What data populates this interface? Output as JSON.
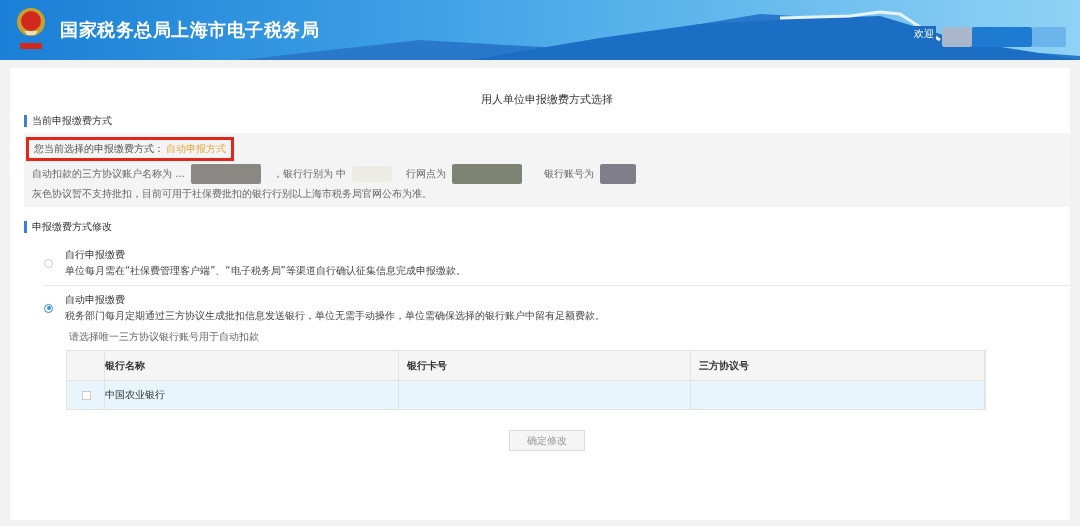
{
  "header": {
    "title": "国家税务总局上海市电子税务局",
    "welcome": "欢迎"
  },
  "page_title": "用人单位申报缴费方式选择",
  "current": {
    "heading": "当前申报缴费方式",
    "label": "您当前选择的申报缴费方式：",
    "value": "自动申报方式",
    "details": [
      "自动扣款的三方协议账户名称为 ...",
      "，银行行别为 中",
      "行网点为",
      "银行账号为"
    ],
    "note": "灰色协议暂不支持批扣，目前可用于社保费批扣的银行行别以上海市税务局官网公布为准。"
  },
  "change": {
    "heading": "申报缴费方式修改",
    "options": [
      {
        "title": "自行申报缴费",
        "description": "单位每月需在“社保费管理客户端”、“电子税务局”等渠道自行确认征集信息完成申报缴款。",
        "selected": false
      },
      {
        "title": "自动申报缴费",
        "description": "税务部门每月定期通过三方协议生成批扣信息发送银行，单位无需手动操作，单位需确保选择的银行账户中留有足额费款。",
        "selected": true
      }
    ],
    "table_hint": "请选择唯一三方协议银行账号用于自动扣款",
    "table": {
      "columns": [
        "银行名称",
        "银行卡号",
        "三方协议号"
      ],
      "rows": [
        {
          "bank": "中国农业银行",
          "checked": false
        }
      ]
    },
    "confirm": "确定修改"
  }
}
